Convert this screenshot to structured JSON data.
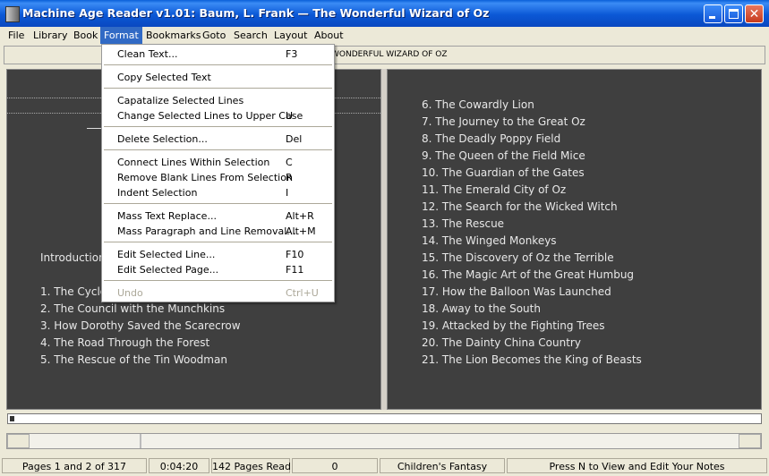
{
  "window": {
    "title": "Machine Age Reader v1.01: Baum, L. Frank — The Wonderful Wizard of Oz"
  },
  "menubar": {
    "file": "File",
    "library": "Library",
    "book": "Book",
    "format": "Format",
    "bookmarks": "Bookmarks",
    "goto": "Goto",
    "search": "Search",
    "layout": "Layout",
    "about": "About"
  },
  "format_menu": {
    "items": [
      {
        "label": "Clean Text...",
        "shortcut": "F3"
      },
      {
        "label": "Copy Selected Text",
        "shortcut": ""
      },
      {
        "label": "Capatalize Selected Lines",
        "shortcut": ""
      },
      {
        "label": "Change Selected Lines to Upper Case",
        "shortcut": "U"
      },
      {
        "label": "Delete Selection...",
        "shortcut": "Del"
      },
      {
        "label": "Connect Lines Within Selection",
        "shortcut": "C"
      },
      {
        "label": "Remove Blank Lines From Selection",
        "shortcut": "R"
      },
      {
        "label": "Indent Selection",
        "shortcut": "I"
      },
      {
        "label": "Mass Text Replace...",
        "shortcut": "Alt+R"
      },
      {
        "label": "Mass Paragraph and Line Removal...",
        "shortcut": "Alt+M"
      },
      {
        "label": "Edit Selected Line...",
        "shortcut": "F10"
      },
      {
        "label": "Edit Selected Page...",
        "shortcut": "F11"
      },
      {
        "label": "Undo",
        "shortcut": "Ctrl+U"
      }
    ]
  },
  "book_bar": {
    "title": "E WONDERFUL WIZARD OF OZ"
  },
  "left_page": {
    "introduction": "Introduction",
    "lines": [
      "1.  The Cyclone",
      "2.  The Council with the Munchkins",
      "3.  How Dorothy Saved the Scarecrow",
      "4.  The Road Through the Forest",
      "5.  The Rescue of the Tin Woodman"
    ]
  },
  "right_page": {
    "lines": [
      "6.  The Cowardly Lion",
      "7.  The Journey to the Great Oz",
      "8.  The Deadly Poppy Field",
      "9.  The Queen of the Field Mice",
      "10.  The Guardian of the Gates",
      "11.  The Emerald City of Oz",
      "12.  The Search for the Wicked Witch",
      "13.  The Rescue",
      "14.  The Winged Monkeys",
      "15.  The Discovery of Oz the Terrible",
      "16.  The Magic Art of the Great Humbug",
      "17.  How the Balloon Was Launched",
      "18.  Away to the South",
      "19.  Attacked by the Fighting Trees",
      "20.  The Dainty China Country",
      "21.  The Lion Becomes the King of Beasts"
    ]
  },
  "reading_progress": 0.006,
  "statusbar": {
    "pages": "Pages 1 and 2 of 317",
    "time": "0:04:20",
    "pages_read": "142 Pages Read",
    "count": "0",
    "genre": "Children's Fantasy",
    "hint": "Press N to View and Edit Your Notes"
  },
  "colors": {
    "titlebar": "#0a5fd8",
    "menu_highlight": "#316ac5",
    "page_background": "#3f3f3f",
    "page_text": "#e8e8e8"
  }
}
